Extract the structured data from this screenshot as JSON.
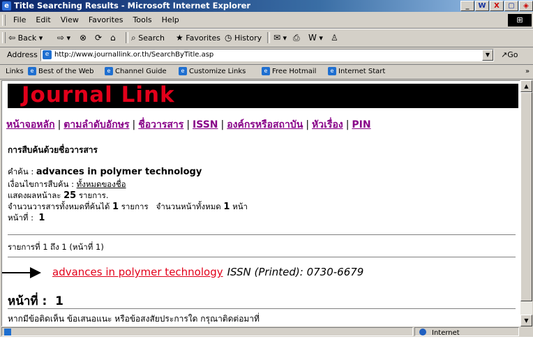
{
  "window": {
    "title": "Title Searching Results - Microsoft Internet Explorer",
    "buttons": [
      "_",
      "W",
      "X",
      "▢",
      "◈"
    ]
  },
  "menu": [
    "File",
    "Edit",
    "View",
    "Favorites",
    "Tools",
    "Help"
  ],
  "toolbar": {
    "back": "Back",
    "search": "Search",
    "favorites": "Favorites",
    "history": "History"
  },
  "address": {
    "label": "Address",
    "url": "http://www.journallink.or.th/SearchByTitle.asp",
    "go": "Go"
  },
  "links": {
    "label": "Links",
    "items": [
      "Best of the Web",
      "Channel Guide",
      "Customize Links",
      "Free Hotmail",
      "Internet Start"
    ]
  },
  "page": {
    "banner": "Journal Link",
    "nav": [
      "หน้าจอหลัก",
      "ตามลำดับอักษร",
      "ชื่อวารสาร",
      "ISSN",
      "องค์กรหรือสถาบัน",
      "หัวเรื่อง",
      "PIN"
    ],
    "heading": "การสืบค้นด้วยชื่อวารสาร",
    "query_label": "คำค้น : ",
    "query_value": "advances in polymer technology",
    "condition_label": "เงื่อนไขการสืบค้น : ",
    "condition_value": "ทั้งหมดของชื่อ",
    "perpage_label": "แสดงผลหน้าละ ",
    "perpage_value": "25",
    "perpage_suffix": " รายการ.",
    "total_label": "จำนวนวารสารทั้งหมดที่ค้นได้ ",
    "total_value": "1",
    "total_mid": " รายการ   จำนวนหน้าทั้งหมด ",
    "pages_value": "1",
    "pages_suffix": " หน้า",
    "pageno_label": "หน้าที่ :  ",
    "pageno_value": "1",
    "range_text": "รายการที่ 1 ถึง 1 (หน้าที่ 1)",
    "result_title": "advances in polymer technology",
    "result_issn": "ISSN (Printed): 0730-6679",
    "pagenum_label": "หน้าที่ :  ",
    "pagenum_value": "1",
    "footer": "หากมีข้อติดเห็น ข้อเสนอแนะ หรือข้อสงสัยประการใด กรุณาติดต่อมาที่"
  },
  "status": {
    "zone": "Internet"
  }
}
